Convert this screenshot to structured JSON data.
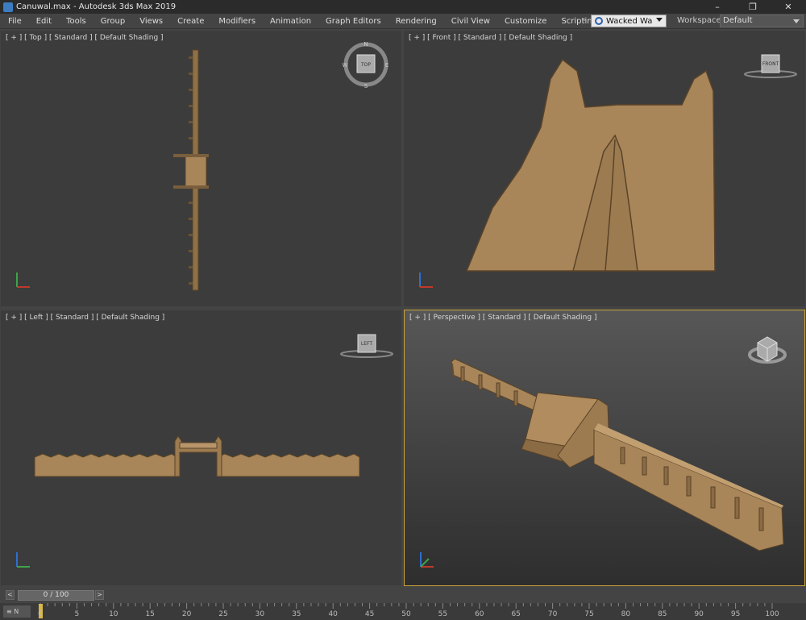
{
  "titlebar": {
    "title": "Canuwal.max - Autodesk 3ds Max 2019",
    "min": "–",
    "max": "❐",
    "close": "✕"
  },
  "menu": [
    "File",
    "Edit",
    "Tools",
    "Group",
    "Views",
    "Create",
    "Modifiers",
    "Animation",
    "Graph Editors",
    "Rendering",
    "Civil View",
    "Customize",
    "Scripting"
  ],
  "menu_overflow": "»",
  "user": {
    "name": "Wacked Wa"
  },
  "workspace": {
    "label": "Workspaces:",
    "value": "Default"
  },
  "viewports": {
    "top": {
      "label": "[ + ] [ Top ] [ Standard ] [ Default Shading ]",
      "cube": "TOP",
      "compass": [
        "N",
        "E",
        "S",
        "W"
      ]
    },
    "front": {
      "label": "[ + ] [ Front ] [ Standard ] [ Default Shading ]",
      "cube": "FRONT"
    },
    "left": {
      "label": "[ + ] [ Left ] [ Standard ] [ Default Shading ]",
      "cube": "LEFT"
    },
    "perspective": {
      "label": "[ + ] [ Perspective ] [ Standard ] [ Default Shading ]"
    }
  },
  "time_slider": {
    "value": "0 / 100",
    "prev": "<",
    "next": ">"
  },
  "timeline": {
    "ticks": [
      "0",
      "5",
      "10",
      "15",
      "20",
      "25",
      "30",
      "35",
      "40",
      "45",
      "50",
      "55",
      "60",
      "65",
      "70",
      "75",
      "80",
      "85",
      "90",
      "95",
      "100"
    ],
    "frame_button": "≡ N"
  },
  "colors": {
    "wall": "#a8865a",
    "wall_dark": "#6b5234",
    "active_border": "#c9a23a",
    "viewport_bg": "#3c3c3c"
  }
}
